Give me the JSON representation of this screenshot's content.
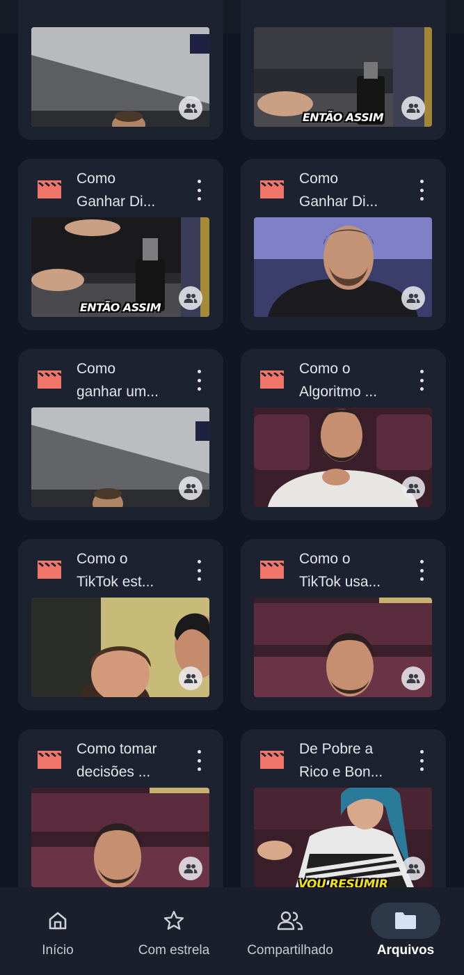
{
  "cards": [
    {
      "title": "",
      "caption": ""
    },
    {
      "title": "",
      "caption": "ENTÃO ASSIM"
    },
    {
      "title": "Como\nGanhar Di...",
      "caption": "ENTÃO ASSIM"
    },
    {
      "title": "Como\nGanhar Di...",
      "caption": ""
    },
    {
      "title": "Como\nganhar um...",
      "caption": ""
    },
    {
      "title": "Como o\nAlgoritmo ...",
      "caption": ""
    },
    {
      "title": "Como o\nTikTok est...",
      "caption": ""
    },
    {
      "title": "Como o\nTikTok usa...",
      "caption": ""
    },
    {
      "title": "Como tomar\ndecisões ...",
      "caption": ""
    },
    {
      "title": "De Pobre a\nRico e Bon...",
      "caption": "VOU RESUMIR"
    }
  ],
  "bottom_nav": {
    "items": [
      {
        "label": "Início",
        "icon": "home-icon"
      },
      {
        "label": "Com estrela",
        "icon": "star-icon"
      },
      {
        "label": "Compartilhado",
        "icon": "people-icon"
      },
      {
        "label": "Arquivos",
        "icon": "folder-icon",
        "active": true
      }
    ]
  },
  "colors": {
    "video_icon": "#f0766a",
    "background": "#121622",
    "card": "#1d2230",
    "active_pill": "#2d3949"
  }
}
